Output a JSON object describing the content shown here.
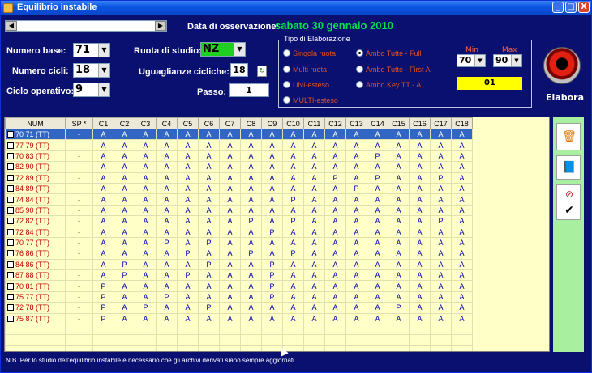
{
  "window": {
    "title": "Equilibrio instabile",
    "controls": [
      "_",
      "□",
      "X"
    ]
  },
  "header": {
    "date_label": "Data di osservazione:",
    "date_value": "sabato 30 gennaio 2010"
  },
  "form": {
    "numero_base_label": "Numero base:",
    "numero_base_value": "71",
    "numero_cicli_label": "Numero cicli:",
    "numero_cicli_value": "18",
    "ciclo_operativo_label": "Ciclo operativo:",
    "ciclo_operativo_value": "9",
    "ruota_label": "Ruota di studio:",
    "ruota_value": "NZ",
    "uguaglianze_label": "Uguaglianze cicliche:",
    "uguaglianze_value": "18",
    "passo_label": "Passo:",
    "passo_value": "1"
  },
  "elaborazione": {
    "legend": "Tipo di Elaborazione",
    "radios_left": [
      "Singola ruota",
      "Multi ruota",
      "UNI-esteso",
      "MULTI-esteso"
    ],
    "radios_right": [
      "Ambo Tutte - Full",
      "Ambo Tutte - First A",
      "Ambo Key TT -  A"
    ],
    "selected": "Ambo Tutte - Full",
    "min_label": "Min",
    "max_label": "Max",
    "min_value": "70",
    "max_value": "90",
    "result": "01"
  },
  "elabora_label": "Elabora",
  "table": {
    "headers": [
      "NUM",
      "SP *",
      "C1",
      "C2",
      "C3",
      "C4",
      "C5",
      "C6",
      "C7",
      "C8",
      "C9",
      "C10",
      "C11",
      "C12",
      "C13",
      "C14",
      "C15",
      "C16",
      "C17",
      "C18"
    ],
    "rows": [
      {
        "num": "70 71  (TT)",
        "sp": "-",
        "c": [
          "A",
          "A",
          "A",
          "A",
          "A",
          "A",
          "A",
          "A",
          "A",
          "A",
          "A",
          "A",
          "A",
          "A",
          "A",
          "A",
          "A",
          "A"
        ]
      },
      {
        "num": "77 79  (TT)",
        "sp": "-",
        "c": [
          "A",
          "A",
          "A",
          "A",
          "A",
          "A",
          "A",
          "A",
          "A",
          "A",
          "A",
          "A",
          "A",
          "A",
          "A",
          "A",
          "A",
          "A"
        ]
      },
      {
        "num": "70 83  (TT)",
        "sp": "-",
        "c": [
          "A",
          "A",
          "A",
          "A",
          "A",
          "A",
          "A",
          "A",
          "A",
          "A",
          "A",
          "A",
          "A",
          "P",
          "A",
          "A",
          "A",
          "A"
        ]
      },
      {
        "num": "82 90  (TT)",
        "sp": "-",
        "c": [
          "A",
          "A",
          "A",
          "A",
          "A",
          "A",
          "A",
          "A",
          "A",
          "A",
          "A",
          "A",
          "A",
          "A",
          "A",
          "A",
          "A",
          "A"
        ]
      },
      {
        "num": "72 89  (TT)",
        "sp": "-",
        "c": [
          "A",
          "A",
          "A",
          "A",
          "A",
          "A",
          "A",
          "A",
          "A",
          "A",
          "A",
          "P",
          "A",
          "P",
          "A",
          "A",
          "P",
          "A"
        ]
      },
      {
        "num": "84 89  (TT)",
        "sp": "-",
        "c": [
          "A",
          "A",
          "A",
          "A",
          "A",
          "A",
          "A",
          "A",
          "A",
          "A",
          "A",
          "A",
          "P",
          "A",
          "A",
          "A",
          "A",
          "A"
        ]
      },
      {
        "num": "74 84  (TT)",
        "sp": "-",
        "c": [
          "A",
          "A",
          "A",
          "A",
          "A",
          "A",
          "A",
          "A",
          "A",
          "P",
          "A",
          "A",
          "A",
          "A",
          "A",
          "A",
          "A",
          "A"
        ]
      },
      {
        "num": "85 90  (TT)",
        "sp": "-",
        "c": [
          "A",
          "A",
          "A",
          "A",
          "A",
          "A",
          "A",
          "A",
          "A",
          "A",
          "A",
          "A",
          "A",
          "A",
          "A",
          "A",
          "A",
          "A"
        ]
      },
      {
        "num": "72 82  (TT)",
        "sp": "-",
        "c": [
          "A",
          "A",
          "A",
          "A",
          "A",
          "A",
          "A",
          "P",
          "A",
          "P",
          "A",
          "A",
          "A",
          "A",
          "A",
          "A",
          "P",
          "A"
        ]
      },
      {
        "num": "72 84  (TT)",
        "sp": "-",
        "c": [
          "A",
          "A",
          "A",
          "A",
          "A",
          "A",
          "A",
          "A",
          "P",
          "A",
          "A",
          "A",
          "A",
          "A",
          "A",
          "A",
          "A",
          "A"
        ]
      },
      {
        "num": "70 77  (TT)",
        "sp": "-",
        "c": [
          "A",
          "A",
          "A",
          "P",
          "A",
          "P",
          "A",
          "A",
          "A",
          "A",
          "A",
          "A",
          "A",
          "A",
          "A",
          "A",
          "A",
          "A"
        ]
      },
      {
        "num": "76 86  (TT)",
        "sp": "-",
        "c": [
          "A",
          "A",
          "A",
          "A",
          "P",
          "A",
          "A",
          "P",
          "A",
          "P",
          "A",
          "A",
          "A",
          "A",
          "A",
          "A",
          "A",
          "A"
        ]
      },
      {
        "num": "84 86  (TT)",
        "sp": "-",
        "c": [
          "A",
          "P",
          "A",
          "A",
          "A",
          "P",
          "A",
          "A",
          "P",
          "A",
          "A",
          "A",
          "A",
          "A",
          "A",
          "A",
          "A",
          "A"
        ]
      },
      {
        "num": "87 88  (TT)",
        "sp": "-",
        "c": [
          "A",
          "P",
          "A",
          "A",
          "P",
          "A",
          "A",
          "A",
          "P",
          "A",
          "A",
          "A",
          "A",
          "A",
          "A",
          "A",
          "A",
          "A"
        ]
      },
      {
        "num": "70 81  (TT)",
        "sp": "-",
        "c": [
          "P",
          "A",
          "A",
          "A",
          "A",
          "A",
          "A",
          "A",
          "P",
          "A",
          "A",
          "A",
          "A",
          "A",
          "A",
          "A",
          "A",
          "A"
        ]
      },
      {
        "num": "75 77  (TT)",
        "sp": "-",
        "c": [
          "P",
          "A",
          "A",
          "P",
          "A",
          "A",
          "A",
          "A",
          "P",
          "A",
          "A",
          "A",
          "A",
          "A",
          "A",
          "A",
          "A",
          "A"
        ]
      },
      {
        "num": "72 78  (TT)",
        "sp": "-",
        "c": [
          "P",
          "A",
          "P",
          "A",
          "A",
          "P",
          "A",
          "A",
          "A",
          "A",
          "A",
          "A",
          "A",
          "A",
          "P",
          "A",
          "A",
          "A"
        ]
      },
      {
        "num": "75 87  (TT)",
        "sp": "-",
        "c": [
          "P",
          "A",
          "A",
          "A",
          "A",
          "A",
          "A",
          "A",
          "A",
          "A",
          "A",
          "A",
          "A",
          "A",
          "A",
          "A",
          "A",
          "A"
        ]
      }
    ]
  },
  "side_icons": [
    "trash-icon",
    "book-icon",
    "cancel-icon",
    "check-icon"
  ],
  "footer": "N.B. Per lo studio dell'equilibrio instabile è necessario che gli archivi derivati siano sempre aggiornati"
}
